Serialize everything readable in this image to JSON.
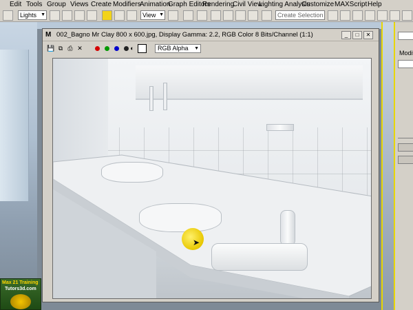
{
  "menubar": {
    "items": [
      "Edit",
      "Tools",
      "Group",
      "Views",
      "Create",
      "Modifiers",
      "Animation",
      "Graph Editors",
      "Rendering",
      "Civil View",
      "Lighting Analysis",
      "Customize",
      "MAXScript",
      "Help"
    ]
  },
  "toolbar": {
    "selection_filter": "Lights",
    "reference_coord": "View",
    "named_selection_placeholder": "Create Selection Se"
  },
  "frame_buffer": {
    "app_icon": "M",
    "caption": "002_Bagno Mr Clay 800 x 600.jpg, Display Gamma: 2.2, RGB Color 8 Bits/Channel (1:1)",
    "channel": "RGB Alpha",
    "colors": {
      "red": "#d40000",
      "green": "#009900",
      "blue": "#0000cc"
    }
  },
  "command_panel": {
    "modifier_label": "Modifie"
  },
  "logo": {
    "line1": "Max 21 Training",
    "line2": "Tutors3d.com"
  }
}
